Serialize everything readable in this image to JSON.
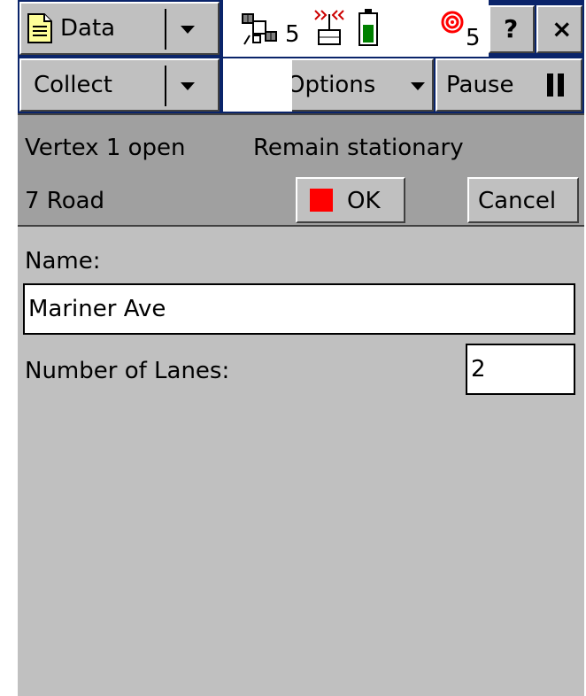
{
  "titlebar": {
    "app_menu_label": "Data",
    "app_menu_icon": "document-icon",
    "satellite_count": "5",
    "correction_count": "5",
    "help_label": "?",
    "close_label": "×"
  },
  "toolbar": {
    "collect_label": "Collect",
    "options_label": "Options",
    "pause_label": "Pause"
  },
  "message": {
    "vertex_status": "Vertex 1 open",
    "instruction": "Remain stationary",
    "feature_label": "7 Road",
    "ok_label": "OK",
    "cancel_label": "Cancel"
  },
  "form": {
    "name_label": "Name:",
    "name_value": "Mariner Ave",
    "lanes_label": "Number of Lanes:",
    "lanes_value": "2"
  },
  "colors": {
    "title_bg": "#0a246a",
    "panel_bg": "#c0c0c0",
    "message_bg": "#a0a0a0",
    "ok_indicator": "#ff0000",
    "battery_level": "#008000"
  }
}
